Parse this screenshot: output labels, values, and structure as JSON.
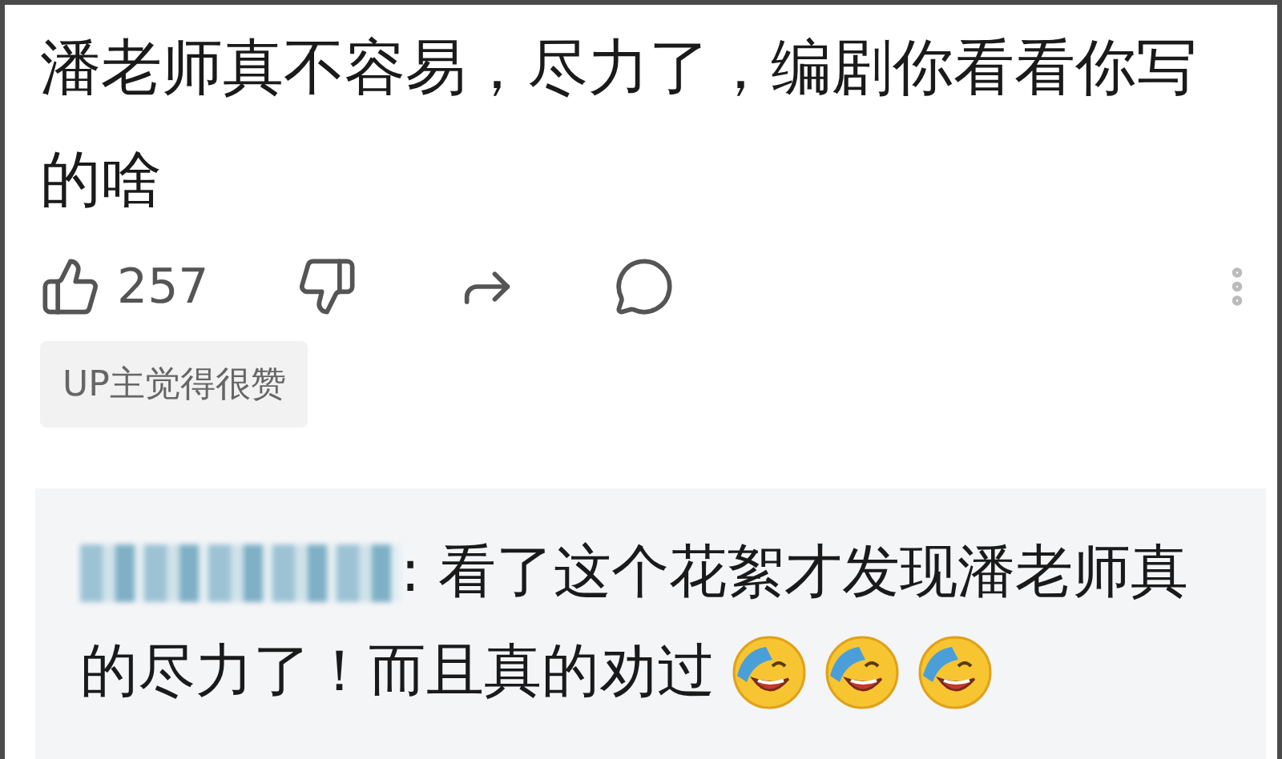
{
  "comment": {
    "text": "潘老师真不容易，尽力了，编剧你看看你写的啥",
    "likes": "257",
    "badge": "UP主觉得很赞"
  },
  "reply": {
    "lines": [
      ": 看了这个花絮才发现潘老师真",
      "的尽力了！而且真的劝过"
    ]
  }
}
